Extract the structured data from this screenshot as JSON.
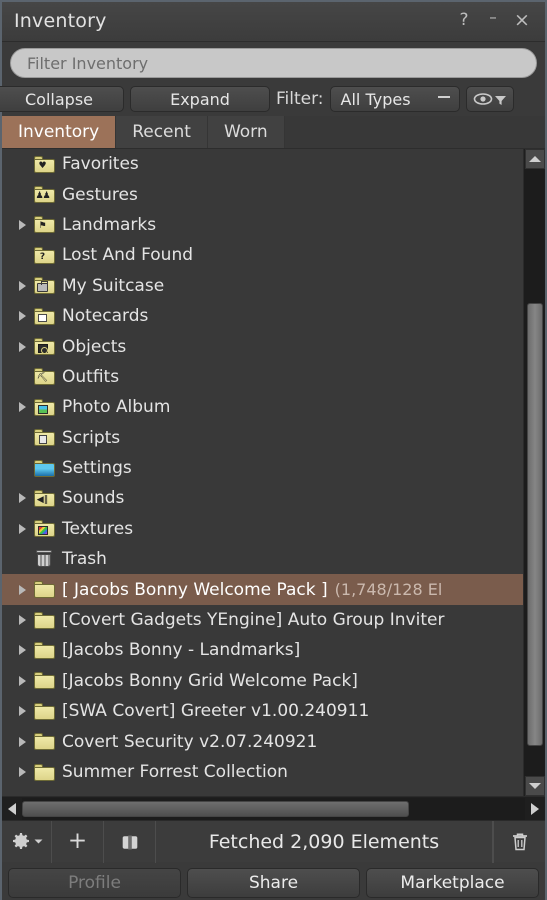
{
  "window": {
    "title": "Inventory",
    "controls": [
      {
        "name": "help-button",
        "glyph": "?"
      },
      {
        "name": "minimize-button",
        "glyph": "–"
      },
      {
        "name": "close-button",
        "glyph": "×"
      }
    ]
  },
  "search": {
    "placeholder": "Filter Inventory",
    "value": ""
  },
  "toolbar": {
    "collapse_label": "Collapse",
    "expand_label": "Expand",
    "filter_label": "Filter:",
    "filter_value": "All Types",
    "filter_icon": "eye-funnel-icon"
  },
  "tabs": [
    {
      "label": "Inventory",
      "active": true
    },
    {
      "label": "Recent",
      "active": false
    },
    {
      "label": "Worn",
      "active": false
    }
  ],
  "list": {
    "rows": [
      {
        "label": "Favorites",
        "count": "",
        "icon": "folder-favorites-icon",
        "glyph": "heart",
        "expandable": false,
        "selected": false
      },
      {
        "label": "Gestures",
        "count": "",
        "icon": "folder-gestures-icon",
        "glyph": "gesture",
        "expandable": false,
        "selected": false
      },
      {
        "label": "Landmarks",
        "count": "",
        "icon": "folder-landmarks-icon",
        "glyph": "landmark",
        "expandable": true,
        "selected": false
      },
      {
        "label": "Lost And Found",
        "count": "",
        "icon": "folder-lostfound-icon",
        "glyph": "question",
        "expandable": false,
        "selected": false
      },
      {
        "label": "My Suitcase",
        "count": "",
        "icon": "folder-suitcase-icon",
        "glyph": "suitcase",
        "expandable": true,
        "selected": false
      },
      {
        "label": "Notecards",
        "count": "",
        "icon": "folder-notecards-icon",
        "glyph": "notecard",
        "expandable": true,
        "selected": false
      },
      {
        "label": "Objects",
        "count": "",
        "icon": "folder-objects-icon",
        "glyph": "object",
        "expandable": true,
        "selected": false
      },
      {
        "label": "Outfits",
        "count": "",
        "icon": "folder-outfits-icon",
        "glyph": "hanger",
        "expandable": false,
        "selected": false
      },
      {
        "label": "Photo Album",
        "count": "",
        "icon": "folder-photoalbum-icon",
        "glyph": "photo",
        "expandable": true,
        "selected": false
      },
      {
        "label": "Scripts",
        "count": "",
        "icon": "folder-scripts-icon",
        "glyph": "script",
        "expandable": false,
        "selected": false
      },
      {
        "label": "Settings",
        "count": "",
        "icon": "folder-settings-icon",
        "glyph": "settings",
        "expandable": false,
        "selected": false
      },
      {
        "label": "Sounds",
        "count": "",
        "icon": "folder-sounds-icon",
        "glyph": "sound",
        "expandable": true,
        "selected": false
      },
      {
        "label": "Textures",
        "count": "",
        "icon": "folder-textures-icon",
        "glyph": "texture",
        "expandable": true,
        "selected": false
      },
      {
        "label": "Trash",
        "count": "",
        "icon": "trash-can-icon",
        "glyph": "trash",
        "expandable": false,
        "selected": false
      },
      {
        "label": "[ Jacobs Bonny Welcome Pack ]",
        "count": "(1,748/128 El",
        "icon": "folder-icon",
        "glyph": "plain",
        "expandable": true,
        "selected": true
      },
      {
        "label": "[Covert Gadgets YEngine] Auto Group Inviter",
        "count": "",
        "icon": "folder-icon",
        "glyph": "plain",
        "expandable": true,
        "selected": false
      },
      {
        "label": "[Jacobs Bonny - Landmarks]",
        "count": "",
        "icon": "folder-icon",
        "glyph": "plain",
        "expandable": true,
        "selected": false
      },
      {
        "label": "[Jacobs Bonny Grid Welcome Pack]",
        "count": "",
        "icon": "folder-icon",
        "glyph": "plain",
        "expandable": true,
        "selected": false
      },
      {
        "label": "[SWA Covert] Greeter v1.00.240911",
        "count": "",
        "icon": "folder-icon",
        "glyph": "plain",
        "expandable": true,
        "selected": false
      },
      {
        "label": "Covert Security v2.07.240921",
        "count": "",
        "icon": "folder-icon",
        "glyph": "plain",
        "expandable": true,
        "selected": false
      },
      {
        "label": "Summer Forrest Collection",
        "count": "",
        "icon": "folder-icon",
        "glyph": "plain",
        "expandable": true,
        "selected": false
      }
    ]
  },
  "statusbar": {
    "gear_icon": "gear-icon",
    "add_icon": "plus-icon",
    "suitcase_icon": "suitcase-icon",
    "status_text": "Fetched 2,090 Elements",
    "trash_icon": "trash-icon"
  },
  "bottom_buttons": [
    {
      "label": "Profile",
      "disabled": true
    },
    {
      "label": "Share",
      "disabled": false
    },
    {
      "label": "Marketplace",
      "disabled": false
    }
  ],
  "colors": {
    "accent": "#9c7259",
    "selection": "#7a5c4c",
    "window_bg": "#3a3a3a",
    "list_bg": "#393939",
    "border": "#5b646e"
  }
}
